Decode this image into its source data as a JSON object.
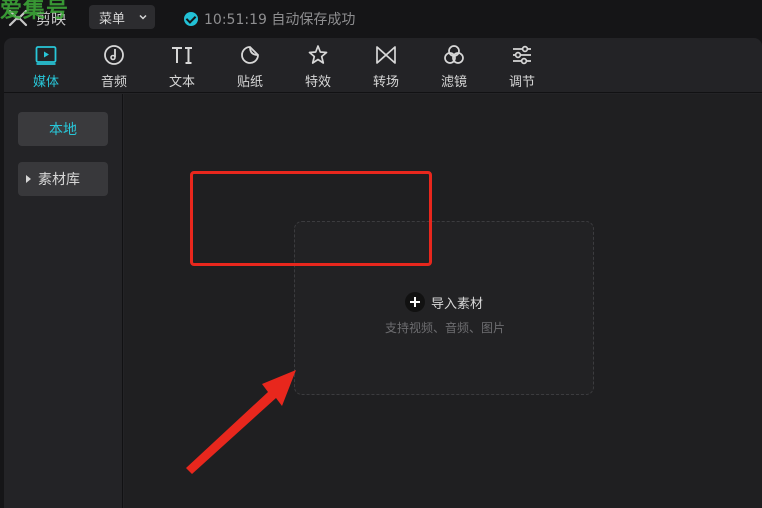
{
  "watermark": "爱集号",
  "titlebar": {
    "app_name": "剪映",
    "menu_label": "菜单",
    "save_status": "10:51:19 自动保存成功"
  },
  "toolbar": {
    "tools": [
      {
        "label": "媒体",
        "icon": "media-icon",
        "active": true
      },
      {
        "label": "音频",
        "icon": "audio-icon"
      },
      {
        "label": "文本",
        "icon": "text-icon"
      },
      {
        "label": "贴纸",
        "icon": "sticker-icon"
      },
      {
        "label": "特效",
        "icon": "effects-icon"
      },
      {
        "label": "转场",
        "icon": "transition-icon"
      },
      {
        "label": "滤镜",
        "icon": "filter-icon"
      },
      {
        "label": "调节",
        "icon": "adjust-icon"
      }
    ]
  },
  "sidebar": {
    "local_label": "本地",
    "library_label": "素材库"
  },
  "dropzone": {
    "import_label": "导入素材",
    "import_hint": "支持视频、音频、图片"
  },
  "colors": {
    "accent": "#28c6d8",
    "highlight": "#e8271d",
    "background": "#151517",
    "panel": "#232326"
  }
}
